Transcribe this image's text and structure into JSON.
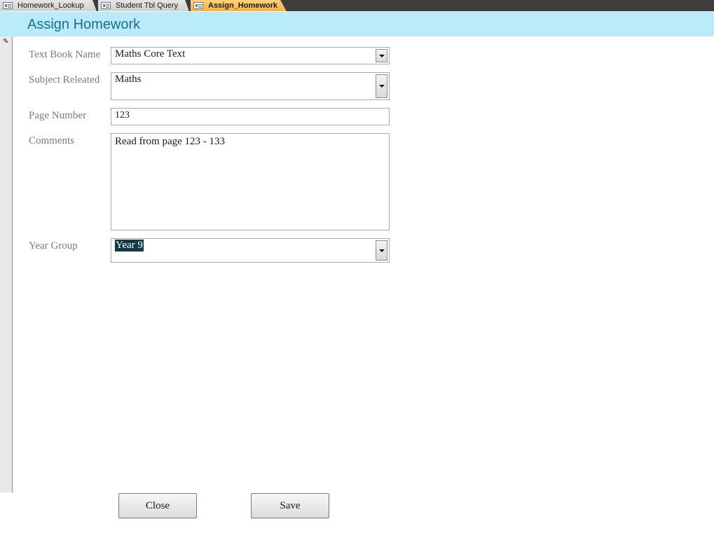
{
  "tabs": [
    {
      "label": "Homework_Lookup"
    },
    {
      "label": "Student Tbl Query"
    },
    {
      "label": "Assign_Homework"
    }
  ],
  "form": {
    "title": "Assign Homework",
    "fields": {
      "textbook": {
        "label": "Text Book Name",
        "value": "Maths Core Text"
      },
      "subject": {
        "label": "Subject Releated",
        "value": "Maths"
      },
      "page": {
        "label": "Page Number",
        "value": "123"
      },
      "comments": {
        "label": "Comments",
        "value": "Read from page 123 - 133"
      },
      "year": {
        "label": "Year Group",
        "value": "Year 9"
      }
    },
    "buttons": {
      "close": "Close",
      "save": "Save"
    }
  },
  "colors": {
    "header_band": "#b9ecf8",
    "title": "#1f6d8e",
    "active_tab": "#f4b23f",
    "selection": "#123a48"
  },
  "icons": [
    "form-icon",
    "pencil-icon",
    "dropdown-arrow-icon"
  ]
}
